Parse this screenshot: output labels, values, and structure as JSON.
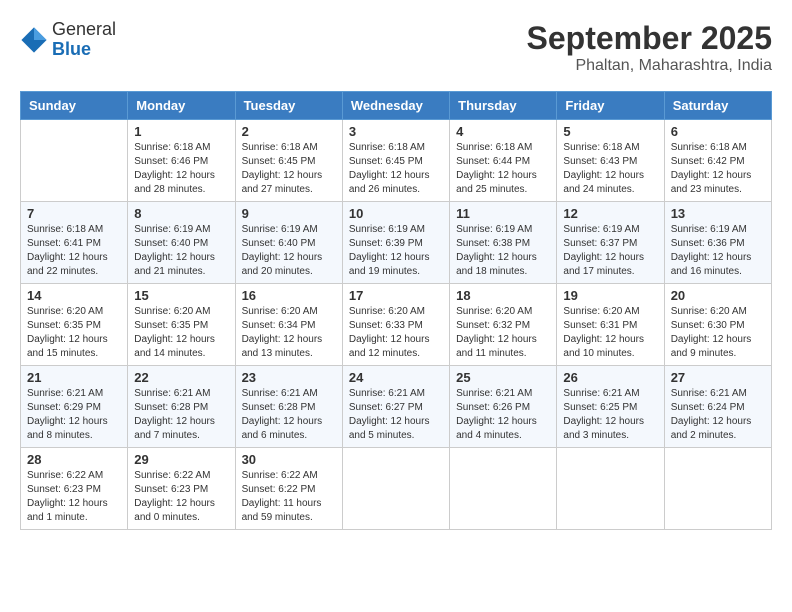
{
  "header": {
    "logo_general": "General",
    "logo_blue": "Blue",
    "month": "September 2025",
    "location": "Phaltan, Maharashtra, India"
  },
  "days_of_week": [
    "Sunday",
    "Monday",
    "Tuesday",
    "Wednesday",
    "Thursday",
    "Friday",
    "Saturday"
  ],
  "weeks": [
    [
      {
        "day": "",
        "info": ""
      },
      {
        "day": "1",
        "info": "Sunrise: 6:18 AM\nSunset: 6:46 PM\nDaylight: 12 hours\nand 28 minutes."
      },
      {
        "day": "2",
        "info": "Sunrise: 6:18 AM\nSunset: 6:45 PM\nDaylight: 12 hours\nand 27 minutes."
      },
      {
        "day": "3",
        "info": "Sunrise: 6:18 AM\nSunset: 6:45 PM\nDaylight: 12 hours\nand 26 minutes."
      },
      {
        "day": "4",
        "info": "Sunrise: 6:18 AM\nSunset: 6:44 PM\nDaylight: 12 hours\nand 25 minutes."
      },
      {
        "day": "5",
        "info": "Sunrise: 6:18 AM\nSunset: 6:43 PM\nDaylight: 12 hours\nand 24 minutes."
      },
      {
        "day": "6",
        "info": "Sunrise: 6:18 AM\nSunset: 6:42 PM\nDaylight: 12 hours\nand 23 minutes."
      }
    ],
    [
      {
        "day": "7",
        "info": "Sunrise: 6:18 AM\nSunset: 6:41 PM\nDaylight: 12 hours\nand 22 minutes."
      },
      {
        "day": "8",
        "info": "Sunrise: 6:19 AM\nSunset: 6:40 PM\nDaylight: 12 hours\nand 21 minutes."
      },
      {
        "day": "9",
        "info": "Sunrise: 6:19 AM\nSunset: 6:40 PM\nDaylight: 12 hours\nand 20 minutes."
      },
      {
        "day": "10",
        "info": "Sunrise: 6:19 AM\nSunset: 6:39 PM\nDaylight: 12 hours\nand 19 minutes."
      },
      {
        "day": "11",
        "info": "Sunrise: 6:19 AM\nSunset: 6:38 PM\nDaylight: 12 hours\nand 18 minutes."
      },
      {
        "day": "12",
        "info": "Sunrise: 6:19 AM\nSunset: 6:37 PM\nDaylight: 12 hours\nand 17 minutes."
      },
      {
        "day": "13",
        "info": "Sunrise: 6:19 AM\nSunset: 6:36 PM\nDaylight: 12 hours\nand 16 minutes."
      }
    ],
    [
      {
        "day": "14",
        "info": "Sunrise: 6:20 AM\nSunset: 6:35 PM\nDaylight: 12 hours\nand 15 minutes."
      },
      {
        "day": "15",
        "info": "Sunrise: 6:20 AM\nSunset: 6:35 PM\nDaylight: 12 hours\nand 14 minutes."
      },
      {
        "day": "16",
        "info": "Sunrise: 6:20 AM\nSunset: 6:34 PM\nDaylight: 12 hours\nand 13 minutes."
      },
      {
        "day": "17",
        "info": "Sunrise: 6:20 AM\nSunset: 6:33 PM\nDaylight: 12 hours\nand 12 minutes."
      },
      {
        "day": "18",
        "info": "Sunrise: 6:20 AM\nSunset: 6:32 PM\nDaylight: 12 hours\nand 11 minutes."
      },
      {
        "day": "19",
        "info": "Sunrise: 6:20 AM\nSunset: 6:31 PM\nDaylight: 12 hours\nand 10 minutes."
      },
      {
        "day": "20",
        "info": "Sunrise: 6:20 AM\nSunset: 6:30 PM\nDaylight: 12 hours\nand 9 minutes."
      }
    ],
    [
      {
        "day": "21",
        "info": "Sunrise: 6:21 AM\nSunset: 6:29 PM\nDaylight: 12 hours\nand 8 minutes."
      },
      {
        "day": "22",
        "info": "Sunrise: 6:21 AM\nSunset: 6:28 PM\nDaylight: 12 hours\nand 7 minutes."
      },
      {
        "day": "23",
        "info": "Sunrise: 6:21 AM\nSunset: 6:28 PM\nDaylight: 12 hours\nand 6 minutes."
      },
      {
        "day": "24",
        "info": "Sunrise: 6:21 AM\nSunset: 6:27 PM\nDaylight: 12 hours\nand 5 minutes."
      },
      {
        "day": "25",
        "info": "Sunrise: 6:21 AM\nSunset: 6:26 PM\nDaylight: 12 hours\nand 4 minutes."
      },
      {
        "day": "26",
        "info": "Sunrise: 6:21 AM\nSunset: 6:25 PM\nDaylight: 12 hours\nand 3 minutes."
      },
      {
        "day": "27",
        "info": "Sunrise: 6:21 AM\nSunset: 6:24 PM\nDaylight: 12 hours\nand 2 minutes."
      }
    ],
    [
      {
        "day": "28",
        "info": "Sunrise: 6:22 AM\nSunset: 6:23 PM\nDaylight: 12 hours\nand 1 minute."
      },
      {
        "day": "29",
        "info": "Sunrise: 6:22 AM\nSunset: 6:23 PM\nDaylight: 12 hours\nand 0 minutes."
      },
      {
        "day": "30",
        "info": "Sunrise: 6:22 AM\nSunset: 6:22 PM\nDaylight: 11 hours\nand 59 minutes."
      },
      {
        "day": "",
        "info": ""
      },
      {
        "day": "",
        "info": ""
      },
      {
        "day": "",
        "info": ""
      },
      {
        "day": "",
        "info": ""
      }
    ]
  ]
}
